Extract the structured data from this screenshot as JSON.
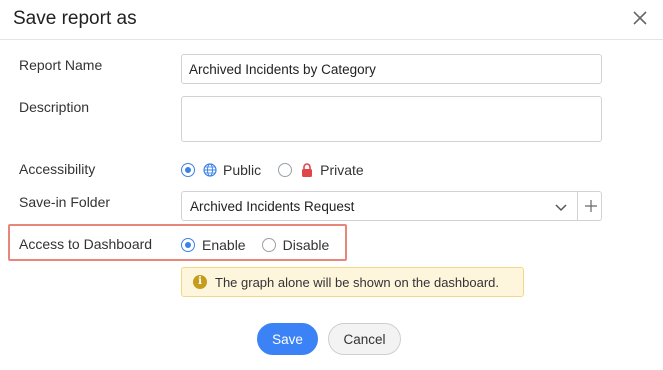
{
  "dialog": {
    "title": "Save report as",
    "close_icon": "close-icon"
  },
  "form": {
    "report_name": {
      "label": "Report Name",
      "value": "Archived Incidents by Category"
    },
    "description": {
      "label": "Description",
      "value": ""
    },
    "accessibility": {
      "label": "Accessibility",
      "options": [
        {
          "label": "Public",
          "icon": "globe-icon",
          "checked": true
        },
        {
          "label": "Private",
          "icon": "lock-icon",
          "checked": false
        }
      ]
    },
    "save_in_folder": {
      "label": "Save-in Folder",
      "selected": "Archived Incidents Request",
      "add_icon": "plus-icon"
    },
    "access_to_dashboard": {
      "label": "Access to Dashboard",
      "options": [
        {
          "label": "Enable",
          "checked": true
        },
        {
          "label": "Disable",
          "checked": false
        }
      ],
      "info": "The graph alone will be shown on the dashboard.",
      "highlight_color": "#e6877a"
    }
  },
  "buttons": {
    "save": "Save",
    "cancel": "Cancel"
  },
  "colors": {
    "accent": "#3b82f6",
    "info_bg": "#fdf6dd",
    "info_border": "#f1d886"
  }
}
